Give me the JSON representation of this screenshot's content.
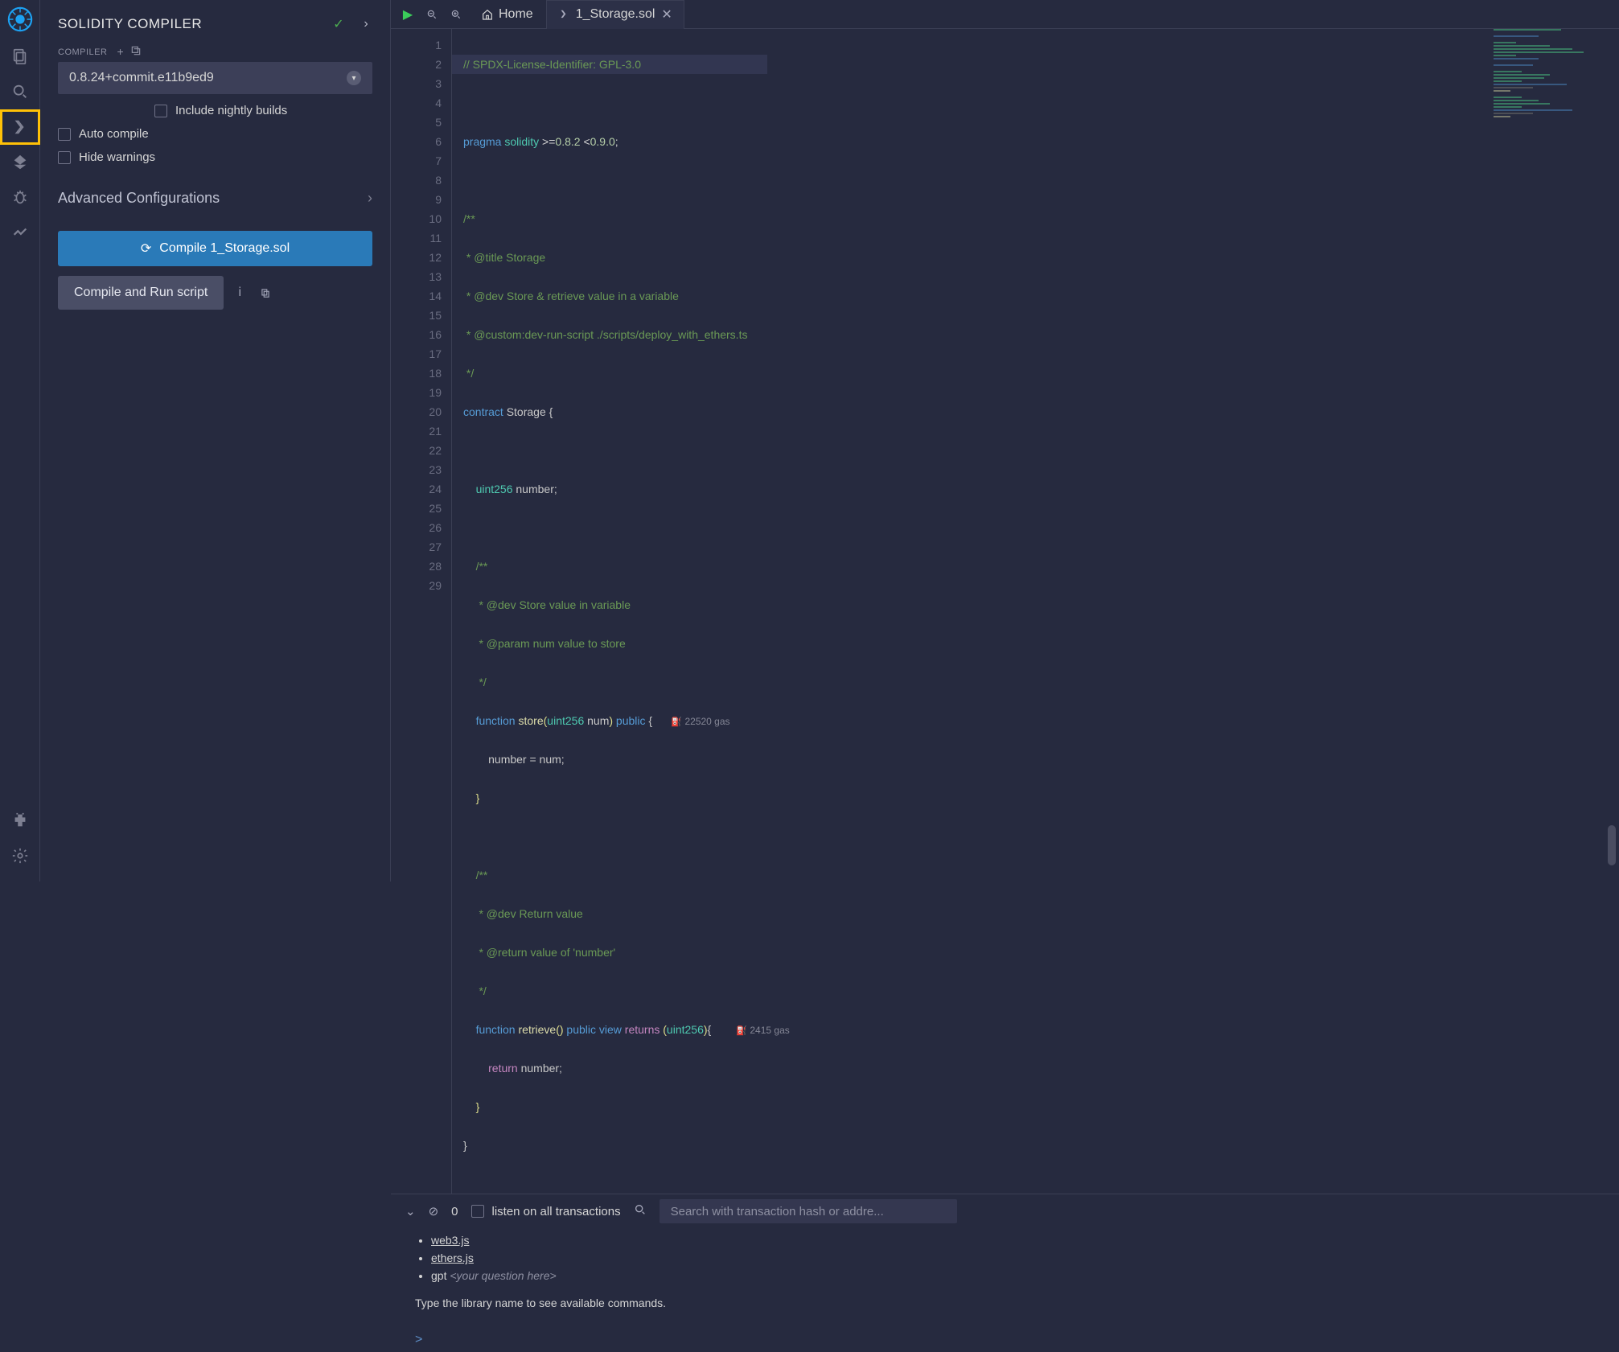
{
  "panel": {
    "title": "SOLIDITY COMPILER",
    "compiler_label": "COMPILER",
    "selected_version": "0.8.24+commit.e11b9ed9",
    "include_nightly": "Include nightly builds",
    "auto_compile": "Auto compile",
    "hide_warnings": "Hide warnings",
    "advanced": "Advanced Configurations",
    "compile_btn": "Compile 1_Storage.sol",
    "compile_run": "Compile and Run script"
  },
  "tabs": {
    "home_label": "Home",
    "file_label": "1_Storage.sol"
  },
  "code": {
    "line1": "// SPDX-License-Identifier: GPL-3.0",
    "line3_pragma": "pragma",
    "line3_solidity": "solidity",
    "line3_rest": ">=0.8.2 <0.9.0;",
    "line5": "/**",
    "line6": " * @title Storage",
    "line7": " * @dev Store & retrieve value in a variable",
    "line8": " * @custom:dev-run-script ./scripts/deploy_with_ethers.ts",
    "line9": " */",
    "line10_contract": "contract",
    "line10_name": " Storage {",
    "line12_type": "uint256",
    "line12_rest": " number;",
    "line14": "/**",
    "line15": " * @dev Store value in variable",
    "line16": " * @param num value to store",
    "line17": " */",
    "line18_func": "function",
    "line18_name": " store",
    "line18_params": "(uint256 num)",
    "line18_mod": " public ",
    "line18_brace": "{",
    "gas1": "22520 gas",
    "line19": "    number = num;",
    "line20": "}",
    "line22": "/**",
    "line23": " * @dev Return value ",
    "line24": " * @return value of 'number'",
    "line25": " */",
    "line26_func": "function",
    "line26_name": " retrieve",
    "line26_parens": "()",
    "line26_mod": " public view ",
    "line26_ret": "returns",
    "line26_rest": " (uint256){",
    "gas2": "2415 gas",
    "line27_ret": "return",
    "line27_rest": " number;",
    "line28": "}",
    "line29": "}"
  },
  "terminal": {
    "count": "0",
    "listen": "listen on all transactions",
    "search_placeholder": "Search with transaction hash or addre...",
    "web3": "web3.js",
    "ethers": "ethers.js",
    "gpt": "gpt ",
    "gpt_italic": "<your question here>",
    "hint": "Type the library name to see available commands.",
    "prompt": ">"
  }
}
